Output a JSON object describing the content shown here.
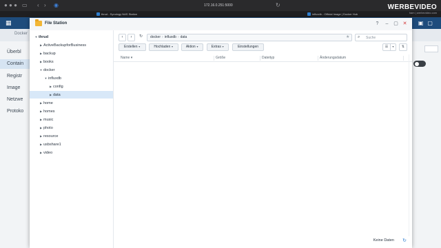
{
  "browser": {
    "url": "172.16.0.251:5000",
    "tabs": [
      {
        "label": "thrud - Synology NAS Station"
      },
      {
        "label": "influxdb - Official Image | Docker Hub"
      }
    ],
    "watermark": {
      "brand": "WERBEVIDEO",
      "sub": "ham | werbevideo.com"
    }
  },
  "background_app": {
    "title": "Docker",
    "nav": [
      "Überbl",
      "Contain",
      "Registr",
      "Image",
      "Netzwe",
      "Protoko"
    ]
  },
  "file_station": {
    "title": "File Station",
    "window_buttons": [
      "?",
      "–",
      "▢",
      "✕"
    ],
    "tree": [
      {
        "label": "thrud",
        "arrow": "▼",
        "indent": 0,
        "bold": true
      },
      {
        "label": "ActiveBackupforBusiness",
        "arrow": "▶",
        "indent": 1
      },
      {
        "label": "backup",
        "arrow": "▶",
        "indent": 1
      },
      {
        "label": "books",
        "arrow": "▶",
        "indent": 1
      },
      {
        "label": "docker",
        "arrow": "▼",
        "indent": 1
      },
      {
        "label": "influxdb",
        "arrow": "▼",
        "indent": 2
      },
      {
        "label": "config",
        "arrow": "▶",
        "indent": 3
      },
      {
        "label": "data",
        "arrow": "▶",
        "indent": 3,
        "selected": true
      },
      {
        "label": "home",
        "arrow": "▶",
        "indent": 1
      },
      {
        "label": "homes",
        "arrow": "▶",
        "indent": 1
      },
      {
        "label": "music",
        "arrow": "▶",
        "indent": 1
      },
      {
        "label": "photo",
        "arrow": "▶",
        "indent": 1
      },
      {
        "label": "resource",
        "arrow": "▶",
        "indent": 1
      },
      {
        "label": "usbshare1",
        "arrow": "▶",
        "indent": 1
      },
      {
        "label": "video",
        "arrow": "▶",
        "indent": 1
      }
    ],
    "path": [
      "docker",
      "influxdb",
      "data"
    ],
    "search_placeholder": "Suche",
    "toolbar": {
      "create": "Erstellen",
      "upload": "Hochladen",
      "action": "Aktion",
      "extras": "Extras",
      "settings": "Einstellungen"
    },
    "columns": [
      "Name",
      "Größe",
      "Dateityp",
      "Änderungsdatum"
    ],
    "sort_indicator": "▾",
    "status": "Keine Daten"
  }
}
